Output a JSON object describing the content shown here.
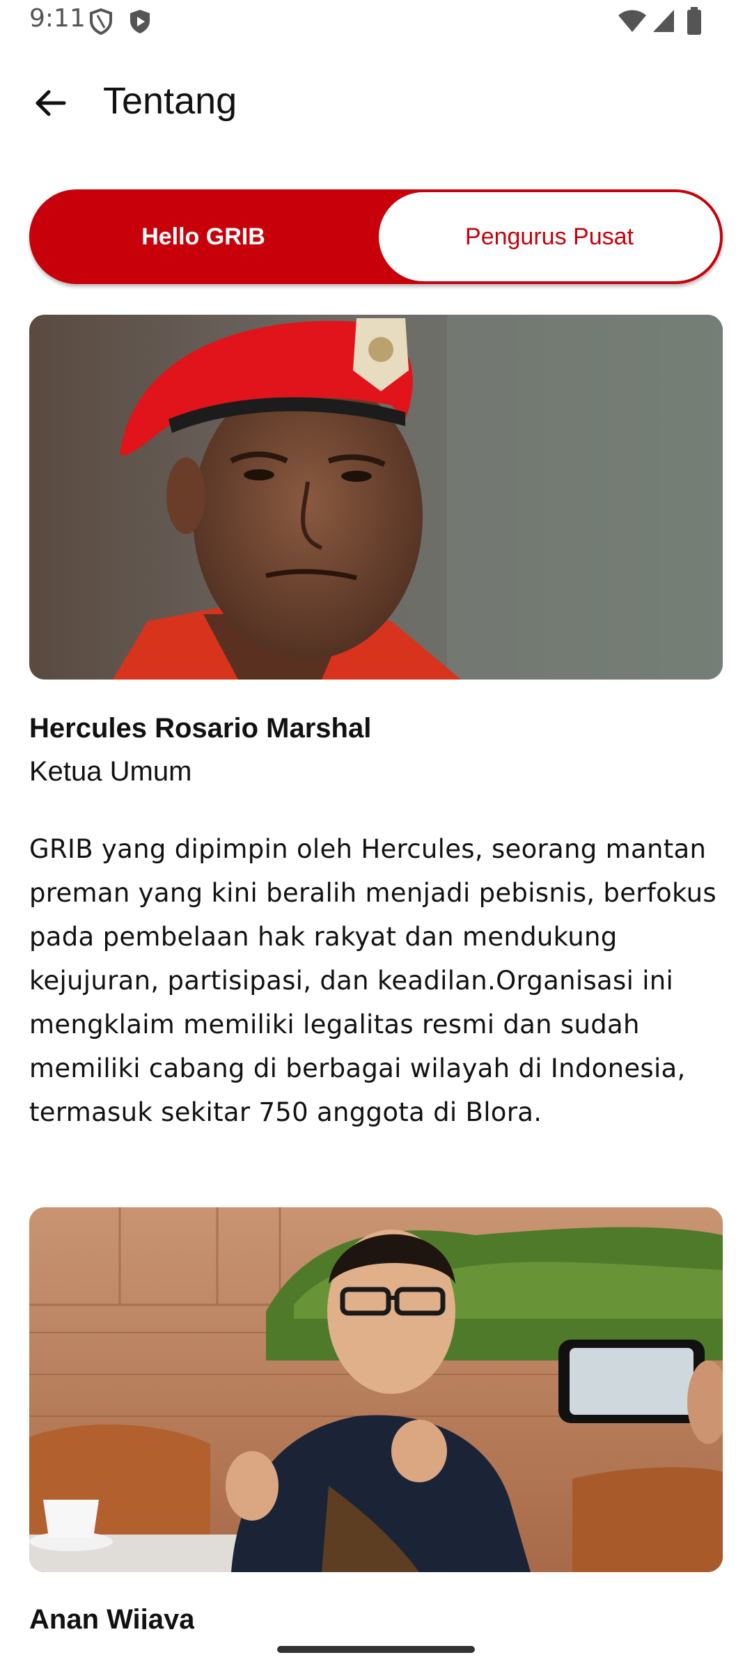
{
  "status_bar": {
    "time": "9:11",
    "icons": [
      "shield-outline-icon",
      "shield-play-icon",
      "wifi-icon",
      "signal-icon",
      "battery-icon"
    ]
  },
  "app_bar": {
    "back_icon": "arrow-back-icon",
    "title": "Tentang"
  },
  "tabs": [
    {
      "label": "Hello GRIB",
      "selected": true
    },
    {
      "label": "Pengurus Pusat",
      "selected": false
    }
  ],
  "profiles": [
    {
      "name": "Hercules Rosario Marshal",
      "role": "Ketua Umum",
      "description": "GRIB yang dipimpin oleh Hercules, seorang mantan preman yang kini beralih menjadi pebisnis, berfokus pada pembelaan hak rakyat dan mendukung kejujuran, partisipasi, dan keadilan.Organisasi ini mengklaim memiliki legalitas resmi dan sudah memiliki cabang di berbagai wilayah di Indonesia, termasuk sekitar 750 anggota di Blora."
    },
    {
      "name": "Anan Wijaya"
    }
  ],
  "colors": {
    "accent": "#c8000a",
    "text": "#111111",
    "background": "#ffffff"
  }
}
